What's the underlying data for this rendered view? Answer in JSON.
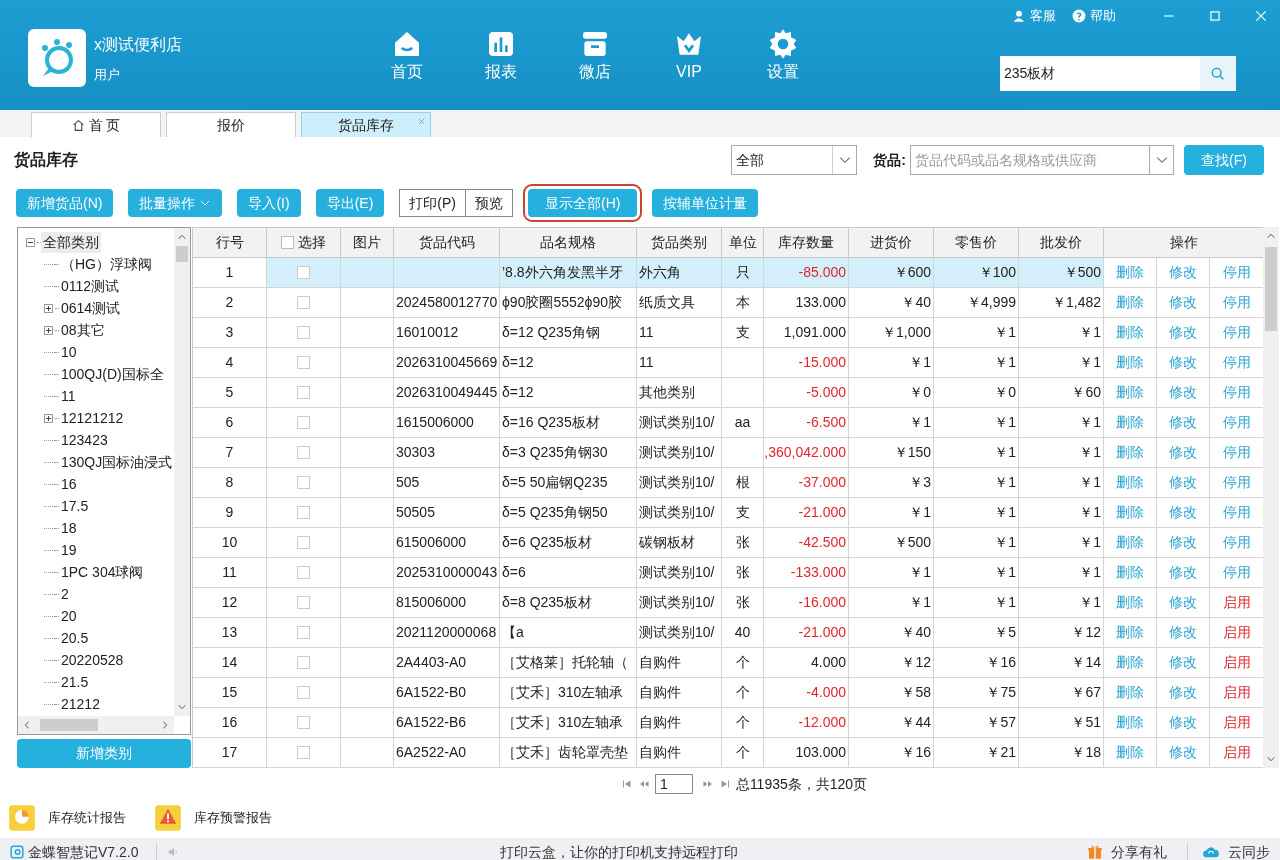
{
  "app": {
    "name": "x测试便利店",
    "user": "用户"
  },
  "nav": [
    {
      "label": "首页",
      "kind": "home"
    },
    {
      "label": "报表",
      "kind": "chart"
    },
    {
      "label": "微店",
      "kind": "store"
    },
    {
      "label": "VIP",
      "kind": "vip"
    },
    {
      "label": "设置",
      "kind": "settings"
    }
  ],
  "header_links": [
    {
      "label": "客服",
      "kind": "service"
    },
    {
      "label": "帮助",
      "kind": "help"
    }
  ],
  "global_search": {
    "value": "235板材"
  },
  "tabs": [
    {
      "label": "首 页",
      "selected": false,
      "kind": "home"
    },
    {
      "label": "报价",
      "selected": false
    },
    {
      "label": "货品库存",
      "selected": true,
      "closable": true
    }
  ],
  "page_title": "货品库存",
  "filter": {
    "scope": "全部",
    "label": "货品:",
    "placeholder": "货品代码或品名规格或供应商",
    "button": "查找(F)"
  },
  "toolbar": [
    {
      "label": "新增货品(N)",
      "kind": "solid"
    },
    {
      "label": "批量操作",
      "kind": "menu"
    },
    {
      "label": "导入(I)",
      "kind": "solid"
    },
    {
      "label": "导出(E)",
      "kind": "solid"
    },
    {
      "label": "打印(P)",
      "kind": "outline"
    },
    {
      "label": "预览",
      "kind": "outline"
    },
    {
      "label": "显示全部(H)",
      "kind": "solid",
      "highlighted": true
    },
    {
      "label": "按辅单位计量",
      "kind": "solid"
    }
  ],
  "tree": {
    "items": [
      {
        "label": "全部类别",
        "expanded": true,
        "selected": true,
        "children": [
          {
            "label": "（HG）浮球阀"
          },
          {
            "label": "0112测试"
          },
          {
            "label": "0614测试",
            "expanded": false
          },
          {
            "label": "08其它",
            "expanded": false
          },
          {
            "label": "10"
          },
          {
            "label": "100QJ(D)国标全"
          },
          {
            "label": "11"
          },
          {
            "label": "12121212",
            "expanded": false
          },
          {
            "label": "123423"
          },
          {
            "label": "130QJ国标油浸式"
          },
          {
            "label": "16"
          },
          {
            "label": "17.5"
          },
          {
            "label": "18"
          },
          {
            "label": "19"
          },
          {
            "label": "1PC 304球阀"
          },
          {
            "label": "2"
          },
          {
            "label": "20"
          },
          {
            "label": "20.5"
          },
          {
            "label": "20220528"
          },
          {
            "label": "21.5"
          },
          {
            "label": "21212"
          }
        ]
      }
    ]
  },
  "new_category_button": "新增类别",
  "table": {
    "columns": [
      "行号",
      "选择",
      "图片",
      "货品代码",
      "品名规格",
      "货品类别",
      "单位",
      "库存数量",
      "进货价",
      "零售价",
      "批发价",
      "操作"
    ],
    "select_all_checked": false,
    "rows": [
      {
        "no": "1",
        "selected": true,
        "checked": false,
        "name": "’8.8外六角发黑半牙",
        "category": "外六角",
        "unit": "只",
        "qty": "-85.000",
        "negative": true,
        "cost": "￥600",
        "retail": "￥100",
        "wholesale": "￥500",
        "actions": [
          "删除",
          "修改",
          "停用"
        ],
        "enabled": true
      },
      {
        "no": "2",
        "selected": false,
        "checked": false,
        "code": "2024580012770",
        "name": "ϕ90胶圈5552ϕ90胶",
        "category": "纸质文具",
        "unit": "本",
        "qty": "133.000",
        "negative": false,
        "cost": "￥40",
        "retail": "￥4,999",
        "wholesale": "￥1,482",
        "actions": [
          "删除",
          "修改",
          "停用"
        ],
        "enabled": true
      },
      {
        "no": "3",
        "selected": false,
        "checked": false,
        "code": "16010012",
        "name": "δ=12 Q235角钢",
        "category": "11",
        "unit": "支",
        "qty": "1,091.000",
        "negative": false,
        "cost": "￥1,000",
        "retail": "￥1",
        "wholesale": "￥1",
        "actions": [
          "删除",
          "修改",
          "停用"
        ],
        "enabled": true
      },
      {
        "no": "4",
        "selected": false,
        "checked": false,
        "code": "2026310045669",
        "name": "δ=12",
        "category": "11",
        "qty": "-15.000",
        "negative": true,
        "cost": "￥1",
        "retail": "￥1",
        "wholesale": "￥1",
        "actions": [
          "删除",
          "修改",
          "停用"
        ],
        "enabled": true
      },
      {
        "no": "5",
        "selected": false,
        "checked": false,
        "code": "2026310049445",
        "name": "δ=12",
        "category": "其他类别",
        "qty": "-5.000",
        "negative": true,
        "cost": "￥0",
        "retail": "￥0",
        "wholesale": "￥60",
        "actions": [
          "删除",
          "修改",
          "停用"
        ],
        "enabled": true
      },
      {
        "no": "6",
        "selected": false,
        "checked": false,
        "code": "1615006000",
        "name": "δ=16 Q235板材",
        "category": "测试类别10/",
        "unit": "aa",
        "qty": "-6.500",
        "negative": true,
        "cost": "￥1",
        "retail": "￥1",
        "wholesale": "￥1",
        "actions": [
          "删除",
          "修改",
          "停用"
        ],
        "enabled": true
      },
      {
        "no": "7",
        "selected": false,
        "checked": false,
        "code": "30303",
        "name": "δ=3 Q235角钢30",
        "category": "测试类别10/",
        "qty": ",360,042.000",
        "negative": true,
        "cost": "￥150",
        "retail": "￥1",
        "wholesale": "￥1",
        "actions": [
          "删除",
          "修改",
          "停用"
        ],
        "enabled": true
      },
      {
        "no": "8",
        "selected": false,
        "checked": false,
        "code": "505",
        "name": "δ=5 50扁钢Q235",
        "category": "测试类别10/",
        "unit": "根",
        "qty": "-37.000",
        "negative": true,
        "cost": "￥3",
        "retail": "￥1",
        "wholesale": "￥1",
        "actions": [
          "删除",
          "修改",
          "停用"
        ],
        "enabled": true
      },
      {
        "no": "9",
        "selected": false,
        "checked": false,
        "code": "50505",
        "name": "δ=5 Q235角钢50",
        "category": "测试类别10/",
        "unit": "支",
        "qty": "-21.000",
        "negative": true,
        "cost": "￥1",
        "retail": "￥1",
        "wholesale": "￥1",
        "actions": [
          "删除",
          "修改",
          "停用"
        ],
        "enabled": true
      },
      {
        "no": "10",
        "selected": false,
        "checked": false,
        "code": "615006000",
        "name": "δ=6 Q235板材",
        "category": "碳钢板材",
        "unit": "张",
        "qty": "-42.500",
        "negative": true,
        "cost": "￥500",
        "retail": "￥1",
        "wholesale": "￥1",
        "actions": [
          "删除",
          "修改",
          "停用"
        ],
        "enabled": true
      },
      {
        "no": "11",
        "selected": false,
        "checked": false,
        "code": "2025310000043",
        "name": "δ=6",
        "category": "测试类别10/",
        "unit": "张",
        "qty": "-133.000",
        "negative": true,
        "cost": "￥1",
        "retail": "￥1",
        "wholesale": "￥1",
        "actions": [
          "删除",
          "修改",
          "停用"
        ],
        "enabled": true
      },
      {
        "no": "12",
        "selected": false,
        "checked": false,
        "code": "815006000",
        "name": "δ=8 Q235板材",
        "category": "测试类别10/",
        "unit": "张",
        "qty": "-16.000",
        "negative": true,
        "cost": "￥1",
        "retail": "￥1",
        "wholesale": "￥1",
        "actions": [
          "删除",
          "修改",
          "启用"
        ],
        "enabled": false
      },
      {
        "no": "13",
        "selected": false,
        "checked": false,
        "code": "2021120000068",
        "name": "【a",
        "category": "测试类别10/",
        "unit": "40",
        "qty": "-21.000",
        "negative": true,
        "cost": "￥40",
        "retail": "￥5",
        "wholesale": "￥12",
        "actions": [
          "删除",
          "修改",
          "启用"
        ],
        "enabled": false
      },
      {
        "no": "14",
        "selected": false,
        "checked": false,
        "code": "2A4403-A0",
        "name": "［艾格莱］托轮轴（",
        "category": "自购件",
        "unit": "个",
        "qty": "4.000",
        "negative": false,
        "cost": "￥12",
        "retail": "￥16",
        "wholesale": "￥14",
        "actions": [
          "删除",
          "修改",
          "启用"
        ],
        "enabled": false
      },
      {
        "no": "15",
        "selected": false,
        "checked": false,
        "code": "6A1522-B0",
        "name": "［艾禾］310左轴承",
        "category": "自购件",
        "unit": "个",
        "qty": "-4.000",
        "negative": true,
        "cost": "￥58",
        "retail": "￥75",
        "wholesale": "￥67",
        "actions": [
          "删除",
          "修改",
          "启用"
        ],
        "enabled": false
      },
      {
        "no": "16",
        "selected": false,
        "checked": false,
        "code": "6A1522-B6",
        "name": "［艾禾］310左轴承",
        "category": "自购件",
        "unit": "个",
        "qty": "-12.000",
        "negative": true,
        "cost": "￥44",
        "retail": "￥57",
        "wholesale": "￥51",
        "actions": [
          "删除",
          "修改",
          "启用"
        ],
        "enabled": false
      },
      {
        "no": "17",
        "selected": false,
        "checked": false,
        "code": "6A2522-A0",
        "name": "［艾禾］齿轮罩壳垫",
        "category": "自购件",
        "unit": "个",
        "qty": "103.000",
        "negative": false,
        "cost": "￥16",
        "retail": "￥21",
        "wholesale": "￥18",
        "actions": [
          "删除",
          "修改",
          "启用"
        ],
        "enabled": false
      }
    ]
  },
  "pagination": {
    "page": "1",
    "summary": "总11935条，共120页"
  },
  "reports": [
    {
      "label": "库存统计报告",
      "kind": "stats"
    },
    {
      "label": "库存预警报告",
      "kind": "warning"
    }
  ],
  "status_bar": {
    "version": "金蝶智慧记V7.2.0",
    "message": "打印云盒，让你的打印机支持远程打印",
    "share": "分享有礼",
    "sync": "云同步"
  }
}
